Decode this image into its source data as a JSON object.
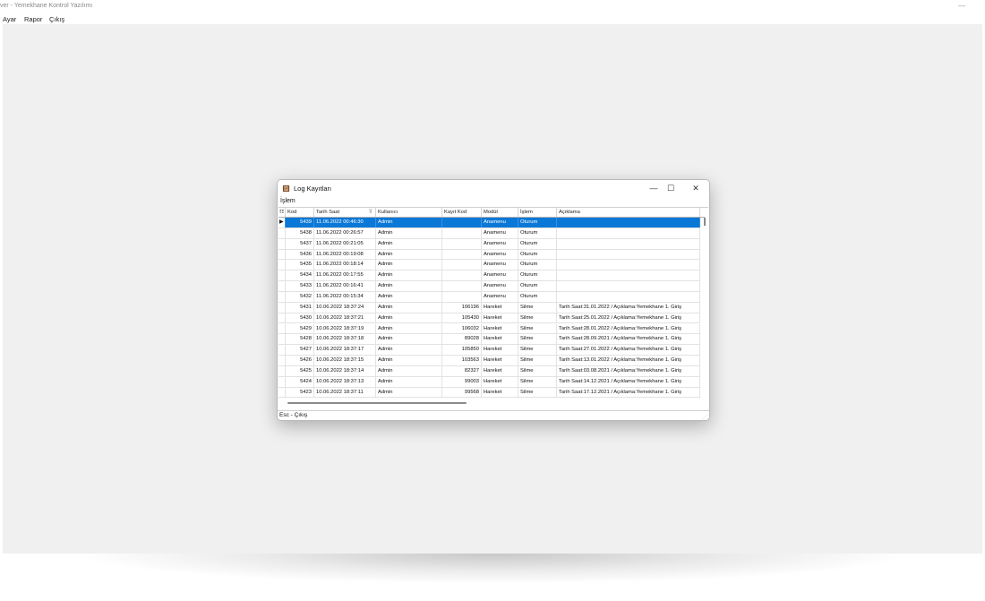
{
  "app": {
    "title": "ver - Yemekhane Kontrol Yazılımı",
    "minimize_glyph": "—",
    "menu": [
      "Ayar",
      "Rapor",
      "Çıkış"
    ]
  },
  "dialog": {
    "title": "Log Kayıtları",
    "icon": "log-book-icon",
    "controls": {
      "minimize": "—",
      "maximize": "☐",
      "close": "✕"
    },
    "menu": [
      "İşlem"
    ],
    "columns": {
      "kod": "Kod",
      "tarih": "Tarih Saat",
      "kullanici": "Kullanıcı",
      "kayit": "Kayıt Kod",
      "modul": "Modül",
      "islem": "İşlem",
      "aciklama": "Açıklama"
    },
    "rows": [
      {
        "kod": "5439",
        "tarih": "11.06.2022 00:46:30",
        "kullanici": "Admin",
        "kayit": "",
        "modul": "Anamenu",
        "islem": "Oturum",
        "aciklama": ""
      },
      {
        "kod": "5438",
        "tarih": "11.06.2022 00:26:57",
        "kullanici": "Admin",
        "kayit": "",
        "modul": "Anamenu",
        "islem": "Oturum",
        "aciklama": ""
      },
      {
        "kod": "5437",
        "tarih": "11.06.2022 00:21:05",
        "kullanici": "Admin",
        "kayit": "",
        "modul": "Anamenu",
        "islem": "Oturum",
        "aciklama": ""
      },
      {
        "kod": "5436",
        "tarih": "11.06.2022 00:19:08",
        "kullanici": "Admin",
        "kayit": "",
        "modul": "Anamenu",
        "islem": "Oturum",
        "aciklama": ""
      },
      {
        "kod": "5435",
        "tarih": "11.06.2022 00:18:14",
        "kullanici": "Admin",
        "kayit": "",
        "modul": "Anamenu",
        "islem": "Oturum",
        "aciklama": ""
      },
      {
        "kod": "5434",
        "tarih": "11.06.2022 00:17:55",
        "kullanici": "Admin",
        "kayit": "",
        "modul": "Anamenu",
        "islem": "Oturum",
        "aciklama": ""
      },
      {
        "kod": "5433",
        "tarih": "11.06.2022 00:16:41",
        "kullanici": "Admin",
        "kayit": "",
        "modul": "Anamenu",
        "islem": "Oturum",
        "aciklama": ""
      },
      {
        "kod": "5432",
        "tarih": "11.06.2022 00:15:34",
        "kullanici": "Admin",
        "kayit": "",
        "modul": "Anamenu",
        "islem": "Oturum",
        "aciklama": ""
      },
      {
        "kod": "5431",
        "tarih": "10.06.2022 18:37:24",
        "kullanici": "Admin",
        "kayit": "106196",
        "modul": "Hareket",
        "islem": "Silme",
        "aciklama": "Tarih Saat:31.01.2022 / Açıklama:Yemekhane 1. Giriş"
      },
      {
        "kod": "5430",
        "tarih": "10.06.2022 18:37:21",
        "kullanici": "Admin",
        "kayit": "105430",
        "modul": "Hareket",
        "islem": "Silme",
        "aciklama": "Tarih Saat:25.01.2022 / Açıklama:Yemekhane 1. Giriş"
      },
      {
        "kod": "5429",
        "tarih": "10.06.2022 18:37:19",
        "kullanici": "Admin",
        "kayit": "106032",
        "modul": "Hareket",
        "islem": "Silme",
        "aciklama": "Tarih Saat:28.01.2022 / Açıklama:Yemekhane 1. Giriş"
      },
      {
        "kod": "5428",
        "tarih": "10.06.2022 18:37:18",
        "kullanici": "Admin",
        "kayit": "89028",
        "modul": "Hareket",
        "islem": "Silme",
        "aciklama": "Tarih Saat:28.09.2021 / Açıklama:Yemekhane 1. Giriş"
      },
      {
        "kod": "5427",
        "tarih": "10.06.2022 18:37:17",
        "kullanici": "Admin",
        "kayit": "105850",
        "modul": "Hareket",
        "islem": "Silme",
        "aciklama": "Tarih Saat:27.01.2022 / Açıklama:Yemekhane 1. Giriş"
      },
      {
        "kod": "5426",
        "tarih": "10.06.2022 18:37:15",
        "kullanici": "Admin",
        "kayit": "103563",
        "modul": "Hareket",
        "islem": "Silme",
        "aciklama": "Tarih Saat:13.01.2022 / Açıklama:Yemekhane 1. Giriş"
      },
      {
        "kod": "5425",
        "tarih": "10.06.2022 18:37:14",
        "kullanici": "Admin",
        "kayit": "82327",
        "modul": "Hareket",
        "islem": "Silme",
        "aciklama": "Tarih Saat:03.08.2021 / Açıklama:Yemekhane 1. Giriş"
      },
      {
        "kod": "5424",
        "tarih": "10.06.2022 18:37:13",
        "kullanici": "Admin",
        "kayit": "99003",
        "modul": "Hareket",
        "islem": "Silme",
        "aciklama": "Tarih Saat:14.12.2021 / Açıklama:Yemekhane 1. Giriş"
      },
      {
        "kod": "5423",
        "tarih": "10.06.2022 18:37:11",
        "kullanici": "Admin",
        "kayit": "99568",
        "modul": "Hareket",
        "islem": "Silme",
        "aciklama": "Tarih Saat:17.12.2021 / Açıklama:Yemekhane 1. Giriş"
      }
    ],
    "selected_row": 0,
    "status": "Esc - Çıkış",
    "colors": {
      "selection": "#0a78d7",
      "workspace": "#f0f0f0"
    }
  }
}
